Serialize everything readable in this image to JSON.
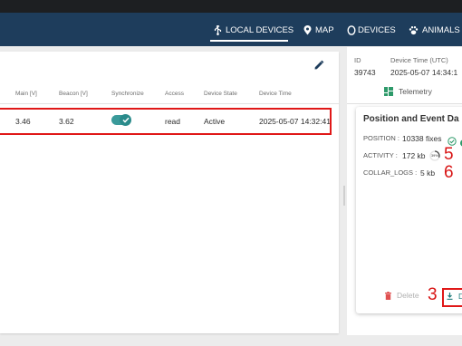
{
  "nav": {
    "items": [
      {
        "label": "LOCAL DEVICES",
        "icon": "usb-icon"
      },
      {
        "label": "MAP",
        "icon": "map-pin-icon"
      },
      {
        "label": "DEVICES",
        "icon": "collar-ring-icon"
      },
      {
        "label": "ANIMALS",
        "icon": "paw-icon"
      }
    ],
    "active": "LOCAL DEVICES"
  },
  "table": {
    "columns": [
      "Main [V]",
      "Beacon [V]",
      "Synchronize",
      "Access",
      "Device State",
      "Device Time"
    ],
    "row": {
      "main_v": "3.46",
      "beacon_v": "3.62",
      "synchronize": true,
      "access": "read",
      "device_state": "Active",
      "device_time": "2025-05-07 14:32:41"
    }
  },
  "side": {
    "id_label": "ID",
    "id_value": "39743",
    "time_label": "Device Time (UTC)",
    "time_value": "2025-05-07 14:34:1",
    "telemetry_tab": "Telemetry",
    "card": {
      "title": "Position and Event Da",
      "position_label": "POSITION :",
      "position_value": "10338 fixes",
      "activity_label": "ACTIVITY :",
      "activity_value": "172 kb",
      "activity_progress": "39%",
      "collar_logs_label": "COLLAR_LOGS :",
      "collar_logs_value": "5 kb",
      "delete_label": "Delete",
      "download_label": "D"
    }
  },
  "annotations": {
    "step_5": "5",
    "step_6": "6",
    "step_3": "3"
  },
  "colors": {
    "nav_bg": "#1e3d5c",
    "accent": "#2a8b8b",
    "highlight": "#e01818",
    "delete": "#e05050"
  }
}
